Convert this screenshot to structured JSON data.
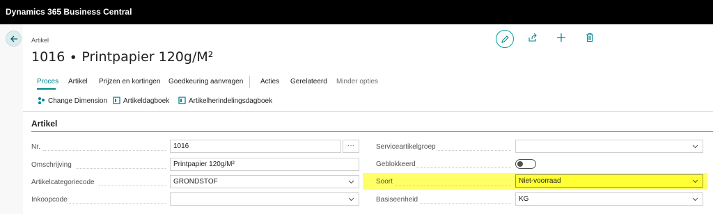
{
  "app": {
    "title": "Dynamics 365 Business Central"
  },
  "header": {
    "caption": "Artikel",
    "title": "1016 ∙ Printpapier 120g/M²",
    "actions": [
      {
        "icon": "edit-icon"
      },
      {
        "icon": "share-icon"
      },
      {
        "icon": "plus-icon"
      },
      {
        "icon": "delete-icon"
      }
    ]
  },
  "tabs": [
    {
      "label": "Proces",
      "active": true
    },
    {
      "label": "Artikel"
    },
    {
      "label": "Prijzen en kortingen"
    },
    {
      "label": "Goedkeuring aanvragen"
    },
    {
      "label": "Acties"
    },
    {
      "label": "Gerelateerd"
    },
    {
      "label": "Minder opties"
    }
  ],
  "actions": [
    {
      "label": "Change Dimension",
      "icon": "dimension-icon"
    },
    {
      "label": "Artikeldagboek",
      "icon": "journal-icon"
    },
    {
      "label": "Artikelherindelingsdagboek",
      "icon": "journal-icon"
    }
  ],
  "section": {
    "title": "Artikel",
    "left": [
      {
        "label": "Nr.",
        "value": "1016"
      },
      {
        "label": "Omschrijving",
        "value": "Printpapier 120g/M²"
      },
      {
        "label": "Artikelcategoriecode",
        "value": "GRONDSTOF"
      },
      {
        "label": "Inkoopcode",
        "value": ""
      }
    ],
    "right": [
      {
        "label": "Serviceartikelgroep",
        "value": ""
      },
      {
        "label": "Geblokkeerd",
        "value": "off"
      },
      {
        "label": "Soort",
        "value": "Niet-voorraad"
      },
      {
        "label": "Basiseenheid",
        "value": "KG"
      }
    ],
    "more_label": "···"
  },
  "colors": {
    "accent": "#00838f",
    "highlight": "#ffff33",
    "topbar": "#000000"
  }
}
